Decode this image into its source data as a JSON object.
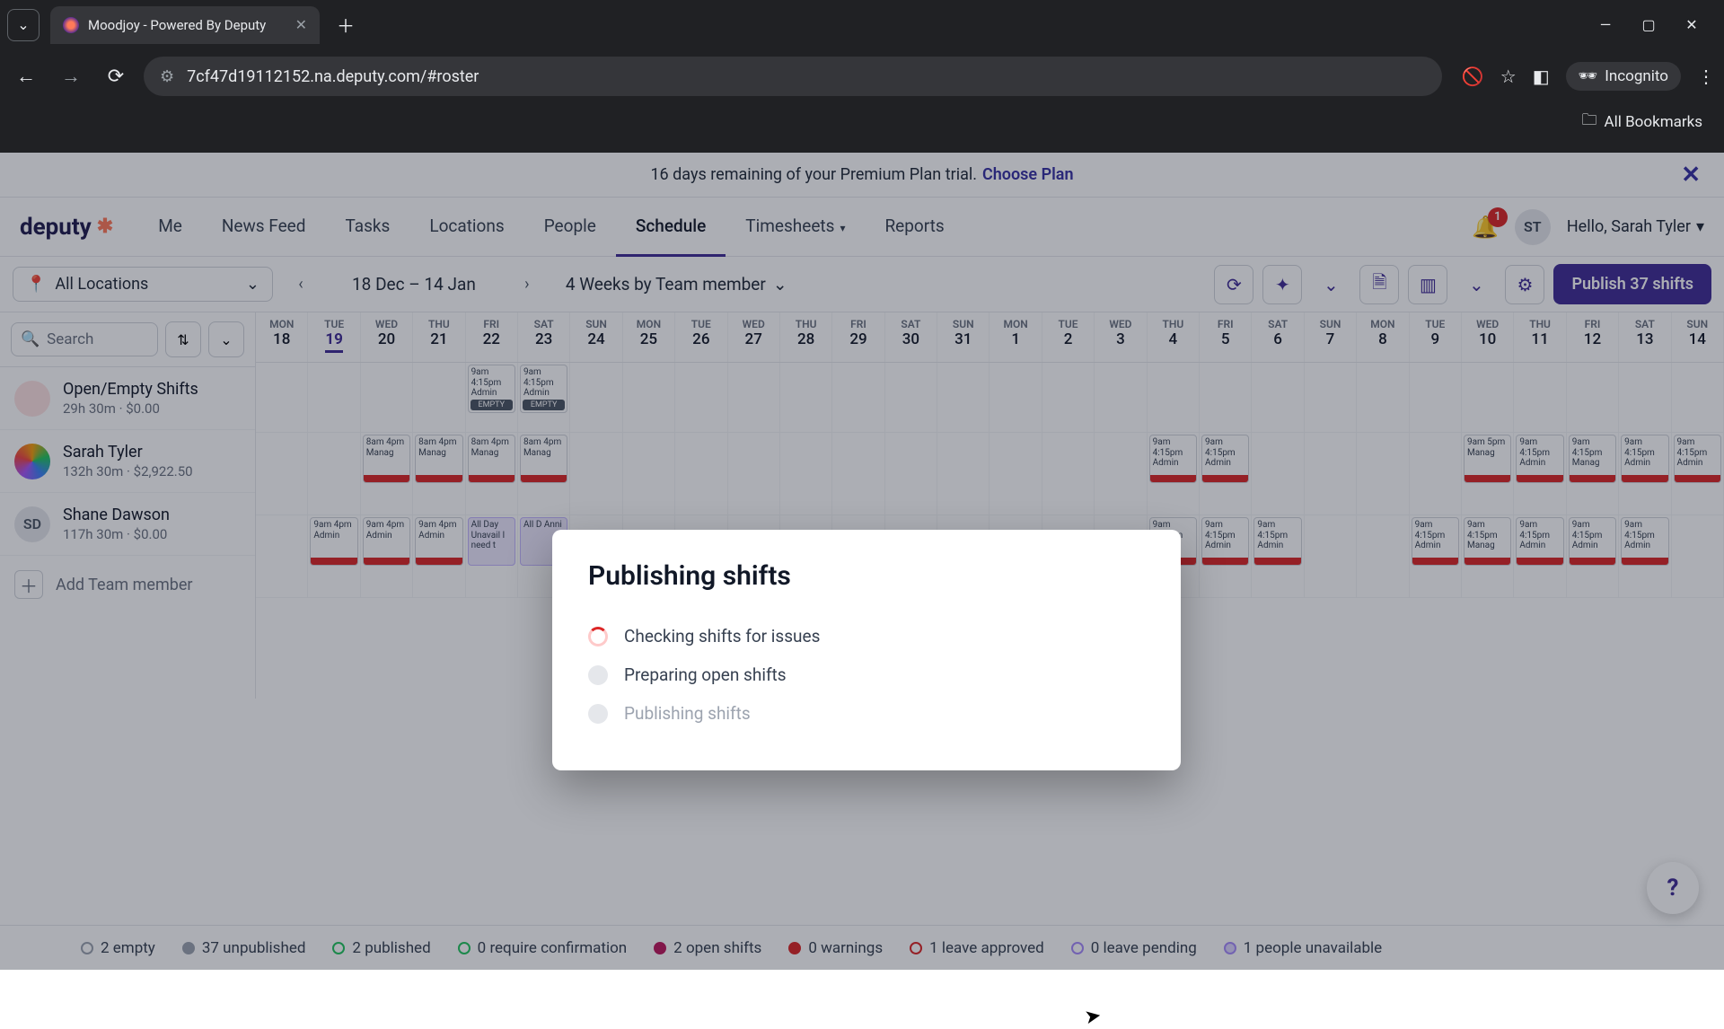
{
  "browser": {
    "tab_title": "Moodjoy - Powered By Deputy",
    "url": "7cf47d19112152.na.deputy.com/#roster",
    "incognito_label": "Incognito",
    "all_bookmarks": "All Bookmarks"
  },
  "banner": {
    "text": "16 days remaining of your Premium Plan trial.",
    "cta": "Choose Plan"
  },
  "nav": {
    "logo": "deputy",
    "items": [
      "Me",
      "News Feed",
      "Tasks",
      "Locations",
      "People",
      "Schedule",
      "Timesheets",
      "Reports"
    ],
    "active_index": 5,
    "bell_badge": "1",
    "avatar_initials": "ST",
    "greeting": "Hello, Sarah Tyler"
  },
  "toolbar": {
    "location": "All Locations",
    "date_range": "18 Dec – 14 Jan",
    "view": "4 Weeks by Team member",
    "publish_label": "Publish 37 shifts"
  },
  "search": {
    "placeholder": "Search"
  },
  "days": [
    {
      "dow": "MON",
      "num": "18"
    },
    {
      "dow": "TUE",
      "num": "19",
      "today": true
    },
    {
      "dow": "WED",
      "num": "20"
    },
    {
      "dow": "THU",
      "num": "21"
    },
    {
      "dow": "FRI",
      "num": "22"
    },
    {
      "dow": "SAT",
      "num": "23"
    },
    {
      "dow": "SUN",
      "num": "24"
    },
    {
      "dow": "MON",
      "num": "25"
    },
    {
      "dow": "TUE",
      "num": "26"
    },
    {
      "dow": "WED",
      "num": "27"
    },
    {
      "dow": "THU",
      "num": "28"
    },
    {
      "dow": "FRI",
      "num": "29"
    },
    {
      "dow": "SAT",
      "num": "30"
    },
    {
      "dow": "SUN",
      "num": "31"
    },
    {
      "dow": "MON",
      "num": "1"
    },
    {
      "dow": "TUE",
      "num": "2"
    },
    {
      "dow": "WED",
      "num": "3"
    },
    {
      "dow": "THU",
      "num": "4"
    },
    {
      "dow": "FRI",
      "num": "5"
    },
    {
      "dow": "SAT",
      "num": "6"
    },
    {
      "dow": "SUN",
      "num": "7"
    },
    {
      "dow": "MON",
      "num": "8"
    },
    {
      "dow": "TUE",
      "num": "9"
    },
    {
      "dow": "WED",
      "num": "10"
    },
    {
      "dow": "THU",
      "num": "11"
    },
    {
      "dow": "FRI",
      "num": "12"
    },
    {
      "dow": "SAT",
      "num": "13"
    },
    {
      "dow": "SUN",
      "num": "14"
    }
  ],
  "rows": [
    {
      "name": "Open/Empty Shifts",
      "meta": "29h 30m · $0.00",
      "avatar": "open",
      "initials": "",
      "cells": [
        null,
        null,
        null,
        null,
        {
          "t": "9am 4:15pm Admin",
          "tag": "empty"
        },
        {
          "t": "9am 4:15pm Admin",
          "tag": "empty"
        },
        null,
        null,
        null,
        null,
        null,
        null,
        null,
        null,
        null,
        null,
        null,
        null,
        null,
        null,
        null,
        null,
        null,
        null,
        null,
        null,
        null,
        null
      ]
    },
    {
      "name": "Sarah Tyler",
      "meta": "132h 30m · $2,922.50",
      "avatar": "st",
      "initials": "",
      "cells": [
        null,
        null,
        {
          "t": "8am 4pm Manag"
        },
        {
          "t": "8am 4pm Manag"
        },
        {
          "t": "8am 4pm Manag"
        },
        {
          "t": "8am 4pm Manag"
        },
        null,
        null,
        null,
        null,
        null,
        null,
        null,
        null,
        null,
        null,
        null,
        {
          "t": "9am 4:15pm Admin"
        },
        {
          "t": "9am 4:15pm Admin"
        },
        null,
        null,
        null,
        null,
        {
          "t": "9am 5pm Manag"
        },
        {
          "t": "9am 4:15pm Admin"
        },
        {
          "t": "9am 4:15pm Manag"
        },
        {
          "t": "9am 4:15pm Admin"
        },
        {
          "t": "9am 4:15pm Admin"
        }
      ]
    },
    {
      "name": "Shane Dawson",
      "meta": "117h 30m · $0.00",
      "avatar": "sd",
      "initials": "SD",
      "cells": [
        null,
        {
          "t": "9am 4pm Admin"
        },
        {
          "t": "9am 4pm Admin"
        },
        {
          "t": "9am 4pm Admin"
        },
        {
          "t": "All Day Unavail I need t",
          "leave": true
        },
        {
          "t": "All D Anni",
          "leave": true
        },
        null,
        null,
        null,
        null,
        null,
        null,
        null,
        null,
        null,
        null,
        null,
        {
          "t": "9am 4:15pm Admin"
        },
        {
          "t": "9am 4:15pm Admin"
        },
        {
          "t": "9am 4:15pm Admin"
        },
        null,
        null,
        {
          "t": "9am 4:15pm Admin"
        },
        {
          "t": "9am 4:15pm Manag"
        },
        {
          "t": "9am 4:15pm Admin"
        },
        {
          "t": "9am 4:15pm Admin"
        },
        {
          "t": "9am 4:15pm Admin"
        },
        null
      ]
    }
  ],
  "add_member": "Add Team member",
  "legend": [
    {
      "label": "2 empty",
      "cls": "grey"
    },
    {
      "label": "37 unpublished",
      "cls": "greyfill"
    },
    {
      "label": "2 published",
      "cls": "green"
    },
    {
      "label": "0 require confirmation",
      "cls": "greenfill"
    },
    {
      "label": "2 open shifts",
      "cls": "pink"
    },
    {
      "label": "0 warnings",
      "cls": "red"
    },
    {
      "label": "1 leave approved",
      "cls": "redO"
    },
    {
      "label": "0 leave pending",
      "cls": "purpleO"
    },
    {
      "label": "1 people unavailable",
      "cls": "purple"
    }
  ],
  "modal": {
    "title": "Publishing shifts",
    "steps": [
      {
        "label": "Checking shifts for issues",
        "state": "active"
      },
      {
        "label": "Preparing open shifts",
        "state": "idle"
      },
      {
        "label": "Publishing shifts",
        "state": "dim"
      }
    ]
  }
}
